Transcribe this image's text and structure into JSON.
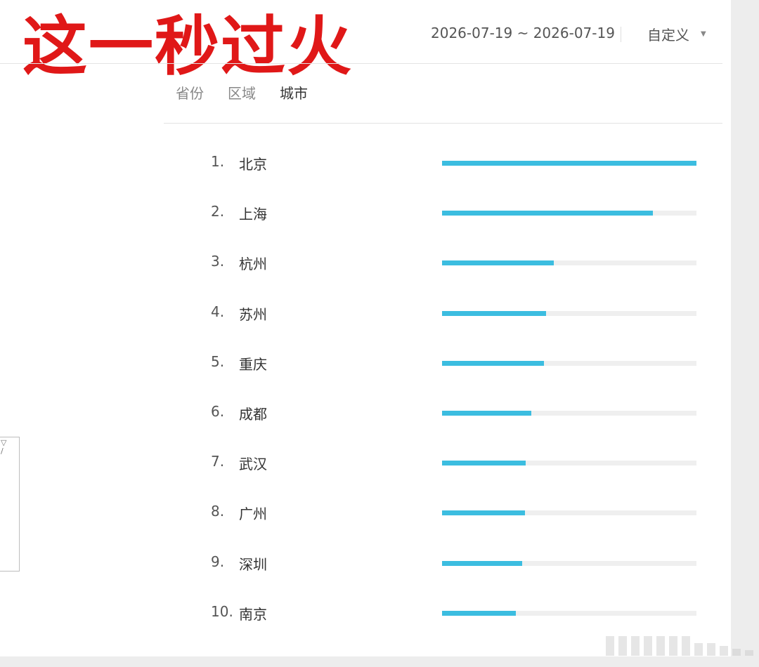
{
  "overlay_title": "这一秒过火",
  "header": {
    "date_range": "2026-07-19 ~ 2026-07-19",
    "custom_label": "自定义",
    "dropdown_icon": "▼"
  },
  "tabs": [
    {
      "label": "省份",
      "active": false
    },
    {
      "label": "区域",
      "active": false
    },
    {
      "label": "城市",
      "active": true
    }
  ],
  "ranking": [
    {
      "rank": "1.",
      "city": "北京",
      "fraction": 1.0
    },
    {
      "rank": "2.",
      "city": "上海",
      "fraction": 0.83
    },
    {
      "rank": "3.",
      "city": "杭州",
      "fraction": 0.44
    },
    {
      "rank": "4.",
      "city": "苏州",
      "fraction": 0.41
    },
    {
      "rank": "5.",
      "city": "重庆",
      "fraction": 0.4
    },
    {
      "rank": "6.",
      "city": "成都",
      "fraction": 0.35
    },
    {
      "rank": "7.",
      "city": "武汉",
      "fraction": 0.33
    },
    {
      "rank": "8.",
      "city": "广州",
      "fraction": 0.325
    },
    {
      "rank": "9.",
      "city": "深圳",
      "fraction": 0.315
    },
    {
      "rank": "10.",
      "city": "南京",
      "fraction": 0.29
    }
  ],
  "colors": {
    "bar_fill": "#3cbde0",
    "bar_track": "#efefef",
    "overlay_text": "#e01818"
  }
}
